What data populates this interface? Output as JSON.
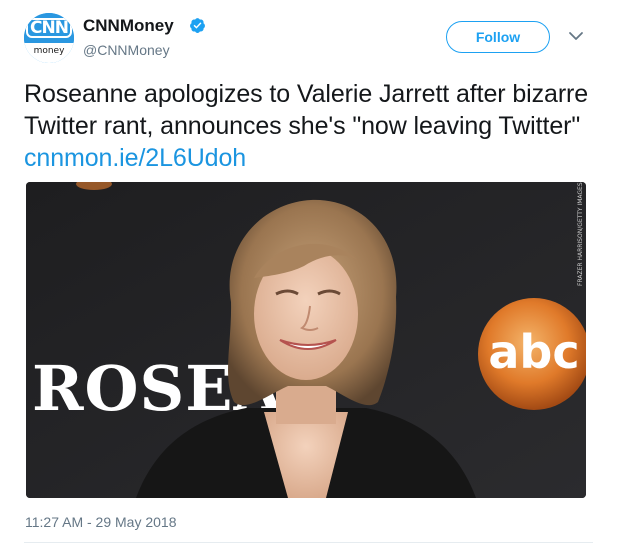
{
  "tweet": {
    "author": {
      "display_name": "CNNMoney",
      "handle": "@CNNMoney",
      "avatar_logo_text": "CNN",
      "avatar_sub_text": "money",
      "verified": true,
      "verified_color": "#1da1f2"
    },
    "follow_label": "Follow",
    "text": "Roseanne apologizes to Valerie Jarrett after bizarre Twitter rant, announces she's \"now leaving Twitter\"",
    "link": "cnnmon.ie/2L6Udoh",
    "image": {
      "sign_text": "ROSEA",
      "logo_text": "abc",
      "photo_credit": "FRAZER HARRISON/GETTY IMAGES"
    },
    "timestamp": "11:27 AM - 29 May 2018"
  },
  "colors": {
    "accent": "#1da1f2",
    "link": "#1b95e0",
    "secondary_text": "#657786"
  },
  "icons": {
    "verified": "verified-badge-icon",
    "menu": "chevron-down-icon"
  }
}
